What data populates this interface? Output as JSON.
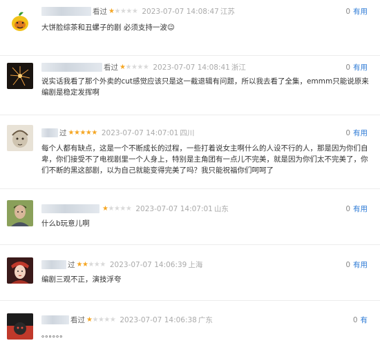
{
  "comments": [
    {
      "watched": "看过",
      "stars": 1,
      "time": "2023-07-07 14:08:47",
      "location": "江苏",
      "useful_count": "0",
      "useful_label": "有用",
      "content": "大饼脸综茶和丑螺子的剧 必须支持一波😉",
      "avatar": "lemon-avatar-icon"
    },
    {
      "watched": "看过",
      "stars": 1,
      "time": "2023-07-07 14:08:41",
      "location": "浙江",
      "useful_count": "0",
      "useful_label": "有用",
      "content": "说实话我看了那个外卖的cut感觉应该只是这一截退辑有问题，所以我去看了全集，emmm只能说原来编剧是稳定发挥啊",
      "avatar": "firework-avatar-icon"
    },
    {
      "watched": "过",
      "stars": 5,
      "time": "2023-07-07 14:07:01",
      "location": "四川",
      "useful_count": "0",
      "useful_label": "有用",
      "content": "每个人都有缺点，这是一个不断成长的过程，一些打着说女主啊什么的人设不行的人，那是因为你们自卑，你们接受不了电视剧里一个人身上，特别是主角团有一点儿不完美，就是因为你们太不完美了，你们不断的黑这部剧，以为自己就能变得完美了吗？我只能祝福你们呵呵了",
      "avatar": "sketch-avatar-icon"
    },
    {
      "watched": "",
      "stars": 1,
      "time": "2023-07-07 14:07:01",
      "location": "山东",
      "useful_count": "0",
      "useful_label": "有用",
      "content": "什么b玩意儿啊",
      "avatar": "man-avatar-icon"
    },
    {
      "watched": "过",
      "stars": 2,
      "time": "2023-07-07 14:06:39",
      "location": "上海",
      "useful_count": "0",
      "useful_label": "有用",
      "content": "编剧三观不正，演技浮夸",
      "avatar": "costume-avatar-icon"
    },
    {
      "watched": "看过",
      "stars": 1,
      "time": "2023-07-07 14:06:38",
      "location": "广东",
      "useful_count": "0",
      "useful_label": "有",
      "content": "。。。。。。",
      "avatar": "dark-avatar-icon"
    }
  ]
}
